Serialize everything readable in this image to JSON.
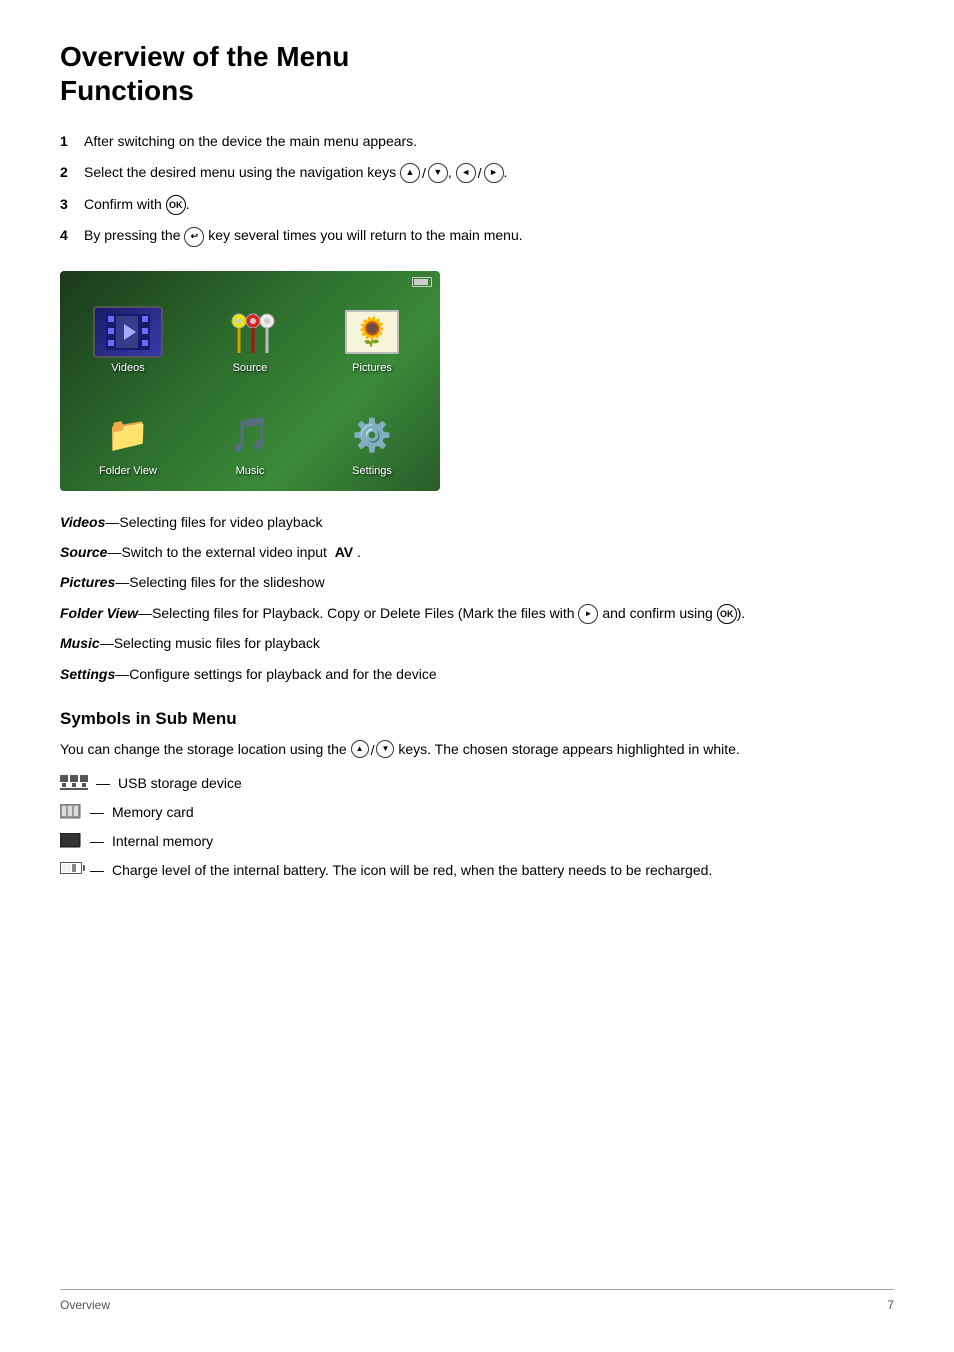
{
  "page": {
    "title_line1": "Overview of the Menu",
    "title_line2": "Functions"
  },
  "steps": [
    {
      "num": "1",
      "text": "After switching on the device the main menu appears."
    },
    {
      "num": "2",
      "text": "Select the desired menu using the navigation keys ▲/▼, ◄/►."
    },
    {
      "num": "3",
      "text": "Confirm with OK."
    },
    {
      "num": "4",
      "text": "By pressing the ↩ key several times you will return to the main menu."
    }
  ],
  "menu_items": [
    {
      "label": "Videos",
      "icon": "video"
    },
    {
      "label": "Source",
      "icon": "source"
    },
    {
      "label": "Pictures",
      "icon": "pictures"
    },
    {
      "label": "Folder View",
      "icon": "folder"
    },
    {
      "label": "Music",
      "icon": "music"
    },
    {
      "label": "Settings",
      "icon": "settings"
    }
  ],
  "descriptions": [
    {
      "term": "Videos",
      "text": "—Selecting files for video playback"
    },
    {
      "term": "Source",
      "text": "—Switch to the external video input  AV ."
    },
    {
      "term": "Pictures",
      "text": "—Selecting files for the slideshow"
    },
    {
      "term": "Folder View",
      "text": "—Selecting files for Playback. Copy or Delete Files (Mark the files with ► and confirm using OK)."
    },
    {
      "term": "Music",
      "text": "—Selecting music files for playback"
    },
    {
      "term": "Settings",
      "text": "—Configure settings for playback and for the device"
    }
  ],
  "symbols_section": {
    "title": "Symbols in Sub Menu",
    "intro": "You can change the storage location using the ▲/▼ keys. The chosen storage appears highlighted in white.",
    "items": [
      {
        "icon_type": "usb",
        "text": "USB storage device"
      },
      {
        "icon_type": "memcard",
        "text": "Memory card"
      },
      {
        "icon_type": "internal",
        "text": "Internal memory"
      },
      {
        "icon_type": "charge",
        "text": "Charge level of the internal battery. The icon will be red, when the battery needs to be recharged."
      }
    ]
  },
  "footer": {
    "left": "Overview",
    "right": "7"
  }
}
